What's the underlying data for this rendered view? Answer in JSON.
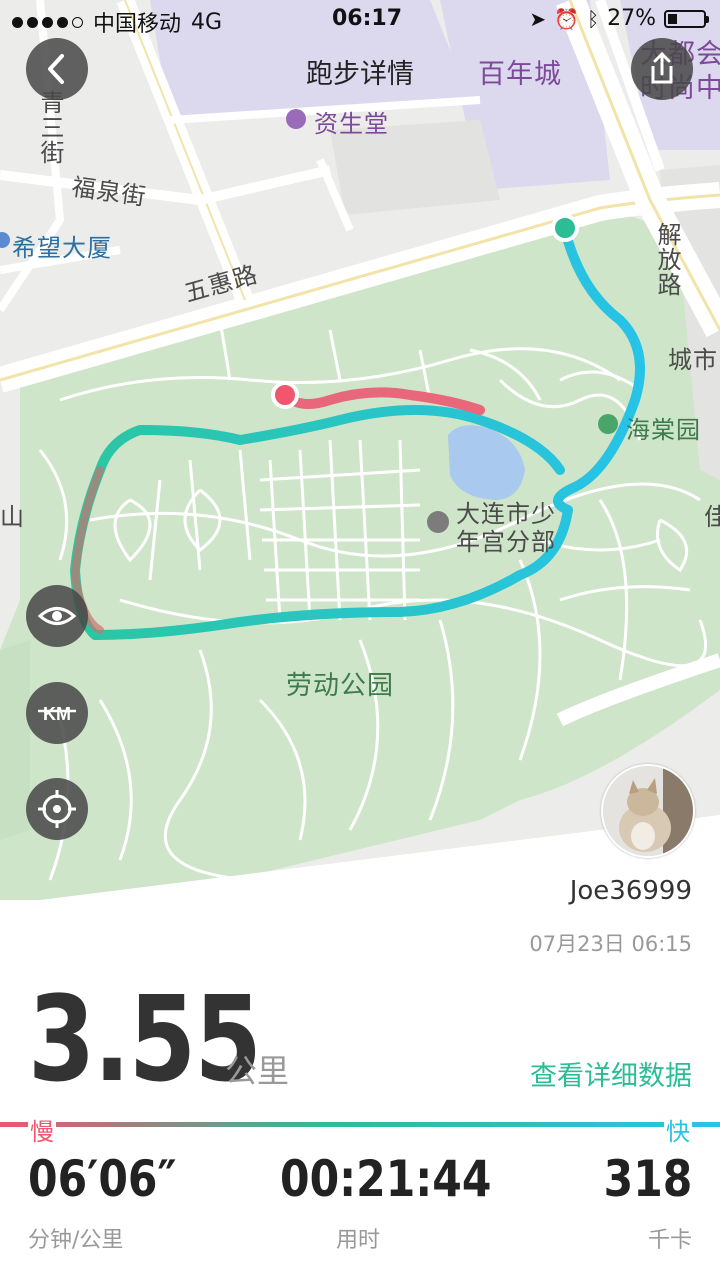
{
  "status_bar": {
    "carrier": "中国移动",
    "network": "4G",
    "time": "06:17",
    "battery": "27%",
    "battery_level": 0.27
  },
  "header": {
    "title": "跑步详情",
    "back_icon": "back-chevron-icon",
    "share_icon": "share-icon"
  },
  "map": {
    "labels": {
      "qingsanjie": "青三街",
      "fuquanjie": "福泉街",
      "xiwangdasha": "希望大厦",
      "wuhuilu": "五惠路",
      "zishengtang": "资生堂",
      "bainiancheng": "百年城",
      "dadu": "大都会",
      "shishang": "时尚中",
      "jiefanglu": "解放路",
      "chengshi": "城市",
      "haitangyuan": "海棠园",
      "shaoniangong": "大连市少",
      "shaoniangong2": "年宫分部",
      "laodonggongyuan": "劳动公园",
      "shan": "山",
      "jia": "佳"
    },
    "controls": [
      "eye-icon",
      "km-icon",
      "locate-icon"
    ],
    "km_label": "KM"
  },
  "user": {
    "name": "Joe36999",
    "datetime": "07月23日 06:15"
  },
  "summary": {
    "distance": "3.55",
    "distance_unit": "公里",
    "detail_link": "查看详细数据",
    "slow_label": "慢",
    "fast_label": "快"
  },
  "stats": [
    {
      "value": "06′06″",
      "label": "分钟/公里"
    },
    {
      "value": "00:21:44",
      "label": "用时"
    },
    {
      "value": "318",
      "label": "千卡"
    }
  ],
  "colors": {
    "accent": "#2bbd95",
    "slow": "#f0566e",
    "fast": "#2bc3e6",
    "park": "#cfe5c9"
  }
}
